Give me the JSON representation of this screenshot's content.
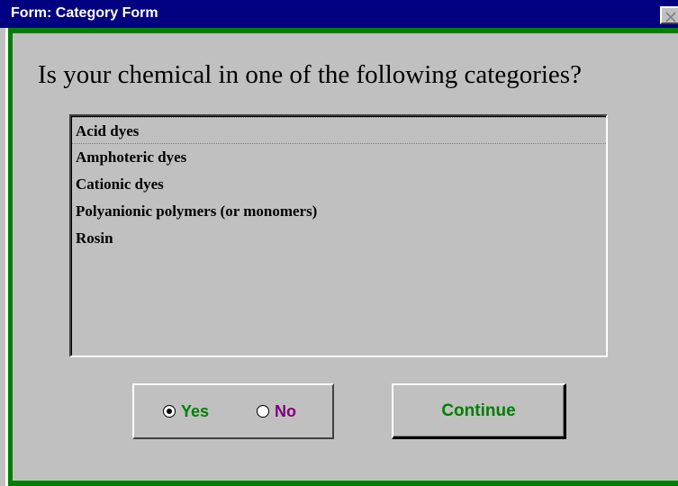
{
  "window": {
    "title": "Form: Category Form"
  },
  "form": {
    "question": "Is your chemical in one of the following categories?",
    "categories": [
      "Acid dyes",
      "Amphoteric dyes",
      "Cationic dyes",
      "Polyanionic polymers (or monomers)",
      "Rosin"
    ],
    "selected_category": "Acid dyes",
    "answer": {
      "options": [
        "Yes",
        "No"
      ],
      "selected": "Yes"
    },
    "continue_label": "Continue"
  },
  "colors": {
    "title_bar": "#000080",
    "frame_green": "#008000",
    "face": "#c0c0c0",
    "yes_label": "#008000",
    "no_label": "#800080",
    "continue_label": "#008000"
  },
  "icons": {
    "close": "close-icon"
  }
}
